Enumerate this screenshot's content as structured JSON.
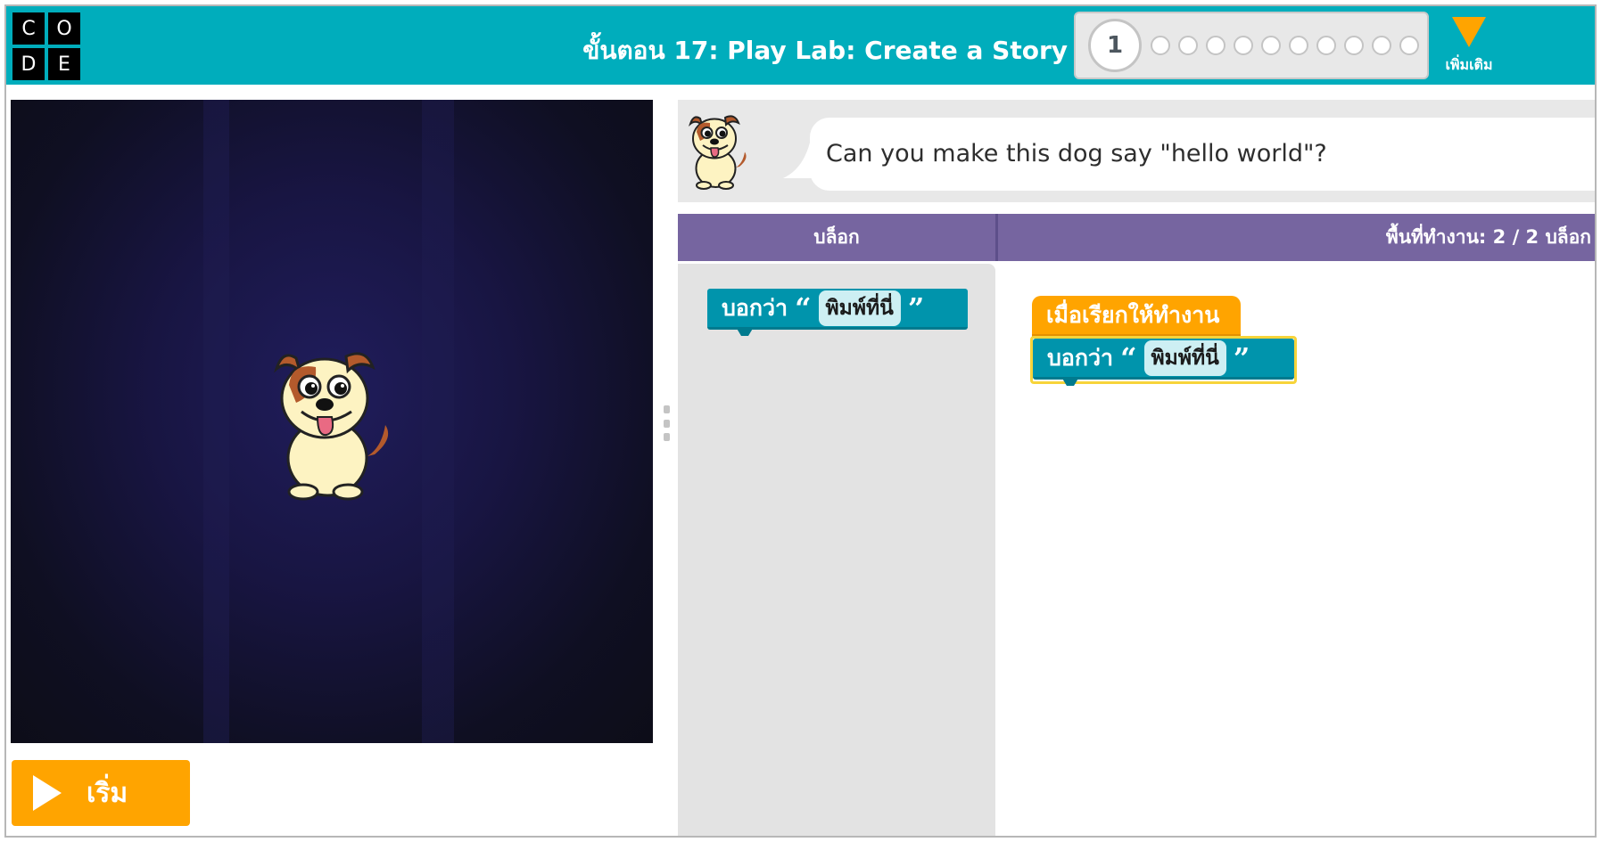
{
  "logo": {
    "letters": [
      "C",
      "O",
      "D",
      "E"
    ]
  },
  "header": {
    "stage_title": "ขั้นตอน 17: Play Lab: Create a Story",
    "progress_current": "1",
    "progress_dots": 10,
    "more_label": "เพิ่มเติม"
  },
  "colors": {
    "header": "#00adbc",
    "run_button": "#ffa400",
    "workspace_header": "#7665a0",
    "say_block": "#0094ac",
    "event_block": "#ffa400",
    "selected_outline": "#f7d43a"
  },
  "stage": {
    "character": "dog-icon"
  },
  "run_button": {
    "label": "เริ่ม",
    "icon": "play-icon"
  },
  "instructions": {
    "text": "Can you make this dog say \"hello world\"?",
    "avatar": "dog-icon"
  },
  "workspace_header": {
    "toolbox_label": "บล็อก",
    "workspace_label": "พื้นที่ทำงาน: 2 / 2 บล็อก"
  },
  "blocks": {
    "say_label": "บอกว่า",
    "say_placeholder": "พิมพ์ที่นี่",
    "open_quote": "“",
    "close_quote": "”",
    "event_label": "เมื่อเรียกให้ทำงาน"
  }
}
